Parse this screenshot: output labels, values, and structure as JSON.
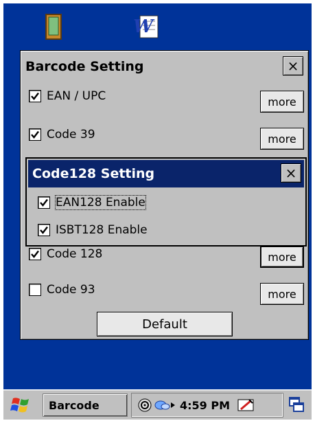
{
  "main_dialog": {
    "title": "Barcode Setting",
    "close_label": "×",
    "options": [
      {
        "label": "EAN / UPC",
        "checked": true,
        "more_label": "more"
      },
      {
        "label": "Code 39",
        "checked": true,
        "more_label": "more"
      },
      {
        "label": "Code 128",
        "checked": true,
        "more_label": "more"
      },
      {
        "label": "Code 93",
        "checked": false,
        "more_label": "more"
      }
    ],
    "default_label": "Default"
  },
  "sub_dialog": {
    "title": "Code128 Setting",
    "close_label": "×",
    "options": [
      {
        "label": "EAN128 Enable",
        "checked": true
      },
      {
        "label": "ISBT128 Enable",
        "checked": true
      }
    ]
  },
  "taskbar": {
    "task_label": "Barcode",
    "time": "4:59 PM"
  },
  "colors": {
    "desktop": "#003399",
    "active_title": "#0a246a",
    "dialog_face": "#c0c0c0"
  },
  "icons": [
    "book-icon",
    "word-doc-icon",
    "start-flag-icon",
    "volume-icon",
    "network-icon",
    "tray-arrow-icon",
    "input-panel-icon",
    "desktop-icon"
  ]
}
